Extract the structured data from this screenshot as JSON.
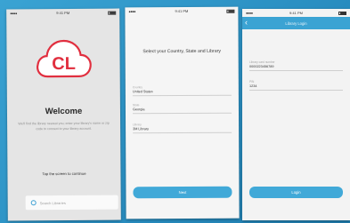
{
  "colors": {
    "accent": "#41a9d8",
    "logo_red": "#e12f3f",
    "background": "#2a93c5"
  },
  "screen1": {
    "status_time": "9:41 PM",
    "logo_text": "CL",
    "welcome_title": "Welcome",
    "description": "We’ll find the library nearest you; enter your library’s name or zip code to connect to your library account.",
    "tap_text": "Tap the screen to continue",
    "search_placeholder": "Search Libraries",
    "search_icon": "search-icon"
  },
  "screen2": {
    "status_time": "9:41 PM",
    "title": "Select your Country, State and Library",
    "fields": [
      {
        "label": "Country",
        "value": "United States"
      },
      {
        "label": "State",
        "value": "Georgia"
      },
      {
        "label": "Library",
        "value": "3M Library"
      }
    ],
    "next_label": "Next"
  },
  "screen3": {
    "status_time": "9:41 PM",
    "nav_title": "Library Login",
    "back_icon": "chevron-left-icon",
    "fields": [
      {
        "label": "Library card number",
        "value": "0000223456789"
      },
      {
        "label": "PIN",
        "value": "1234"
      }
    ],
    "login_label": "Login"
  }
}
